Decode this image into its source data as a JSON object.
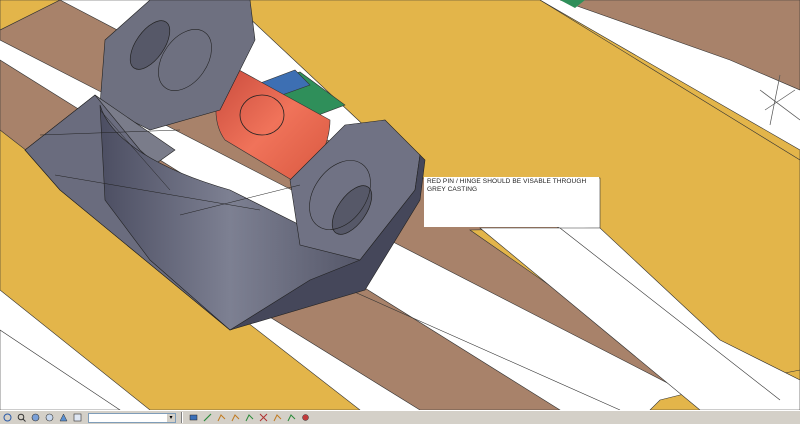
{
  "annotation": {
    "text": "RED PIN / HINGE SHOULD BE VISABLE THROUGH GREY CASTING"
  },
  "colors": {
    "tan_member": "#e3b54a",
    "brown_member": "#a8826a",
    "grey_casting": "#6e7080",
    "grey_casting_dark": "#45475a",
    "red_pin": "#e2604a",
    "blue_rod": "#3d6fb3",
    "green_rod": "#2f8f5a",
    "viewport_bg": "#ffffff",
    "toolbar_bg": "#d4d0c8"
  },
  "toolbar": {
    "left_icons": [
      "orbit-icon",
      "zoom-icon",
      "pan-icon",
      "view-icon",
      "navigate-icon",
      "render-icon"
    ],
    "right_icons": [
      "layer-icon",
      "snap-icon",
      "grid-icon",
      "ortho-icon",
      "polar-icon",
      "osnap-icon",
      "otrack-icon",
      "lweight-icon",
      "model-icon"
    ]
  }
}
